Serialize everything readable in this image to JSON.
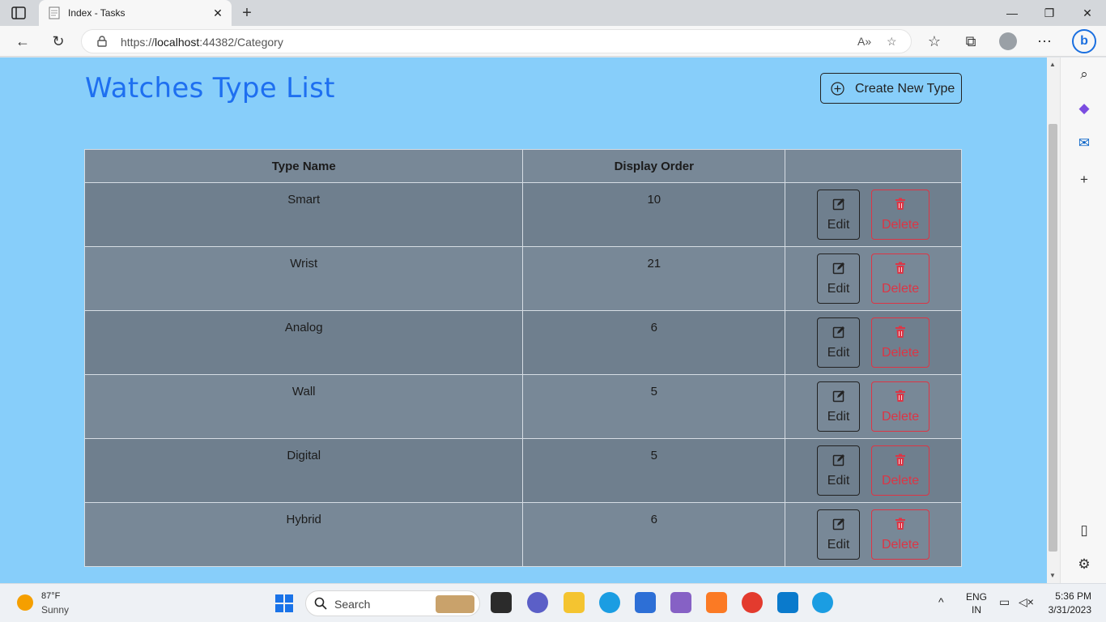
{
  "browser": {
    "tab_title": "Index - Tasks",
    "url_prefix": "https://",
    "url_host": "localhost",
    "url_rest": ":44382/Category"
  },
  "page": {
    "title": "Watches Type List",
    "create_button": "Create New Type",
    "table": {
      "headers": [
        "Type Name",
        "Display Order",
        ""
      ],
      "rows": [
        {
          "name": "Smart",
          "order": "10",
          "edit": "Edit",
          "delete": "Delete"
        },
        {
          "name": "Wrist",
          "order": "21",
          "edit": "Edit",
          "delete": "Delete"
        },
        {
          "name": "Analog",
          "order": "6",
          "edit": "Edit",
          "delete": "Delete"
        },
        {
          "name": "Wall",
          "order": "5",
          "edit": "Edit",
          "delete": "Delete"
        },
        {
          "name": "Digital",
          "order": "5",
          "edit": "Edit",
          "delete": "Delete"
        },
        {
          "name": "Hybrid",
          "order": "6",
          "edit": "Edit",
          "delete": "Delete"
        }
      ]
    }
  },
  "colors": {
    "page_bg": "#87cefa",
    "title": "#1e6ff0",
    "row_dark": "#6f7f8e",
    "row_light": "#788897",
    "delete": "#dc3545"
  },
  "taskbar": {
    "weather_temp": "87°F",
    "weather_cond": "Sunny",
    "search_placeholder": "Search",
    "lang_top": "ENG",
    "lang_bottom": "IN",
    "time": "5:36 PM",
    "date": "3/31/2023"
  }
}
